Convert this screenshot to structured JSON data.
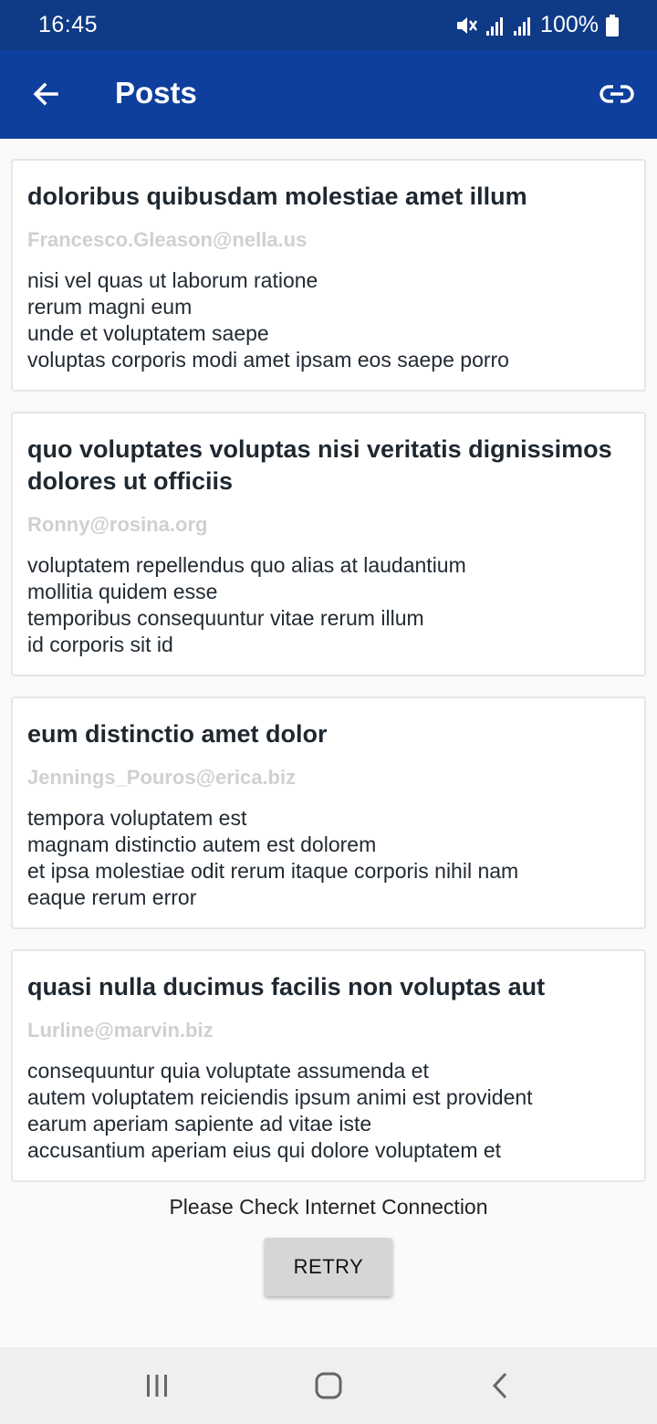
{
  "status_bar": {
    "time": "16:45",
    "battery": "100%",
    "icons": [
      "mute-icon",
      "signal-icon",
      "signal-icon",
      "battery-icon"
    ]
  },
  "app_bar": {
    "title": "Posts",
    "back_icon": "arrow-left-icon",
    "action_icon": "link-icon"
  },
  "posts": [
    {
      "title": "doloribus quibusdam molestiae amet illum",
      "email": "Francesco.Gleason@nella.us",
      "body": [
        "nisi vel quas ut laborum ratione",
        "rerum magni eum",
        "unde et voluptatem saepe",
        "voluptas corporis modi amet ipsam eos saepe porro"
      ]
    },
    {
      "title": "quo voluptates voluptas nisi veritatis dignissimos dolores ut officiis",
      "email": "Ronny@rosina.org",
      "body": [
        "voluptatem repellendus quo alias at laudantium",
        "mollitia quidem esse",
        "temporibus consequuntur vitae rerum illum",
        "id corporis sit id"
      ]
    },
    {
      "title": "eum distinctio amet dolor",
      "email": "Jennings_Pouros@erica.biz",
      "body": [
        "tempora voluptatem est",
        "magnam distinctio autem est dolorem",
        "et ipsa molestiae odit rerum itaque corporis nihil nam",
        "eaque rerum error"
      ]
    },
    {
      "title": "quasi nulla ducimus facilis non voluptas aut",
      "email": "Lurline@marvin.biz",
      "body": [
        "consequuntur quia voluptate assumenda et",
        "autem voluptatem reiciendis ipsum animi est provident",
        "earum aperiam sapiente ad vitae iste",
        "accusantium aperiam eius qui dolore voluptatem et"
      ]
    }
  ],
  "error": {
    "message": "Please Check Internet Connection",
    "retry_label": "RETRY"
  },
  "nav_bar": {
    "icons": [
      "recent-apps-icon",
      "home-icon",
      "back-icon"
    ]
  },
  "colors": {
    "status_bar": "#0e3a86",
    "app_bar": "#0f3f9c",
    "email": "#d0d0d0"
  }
}
